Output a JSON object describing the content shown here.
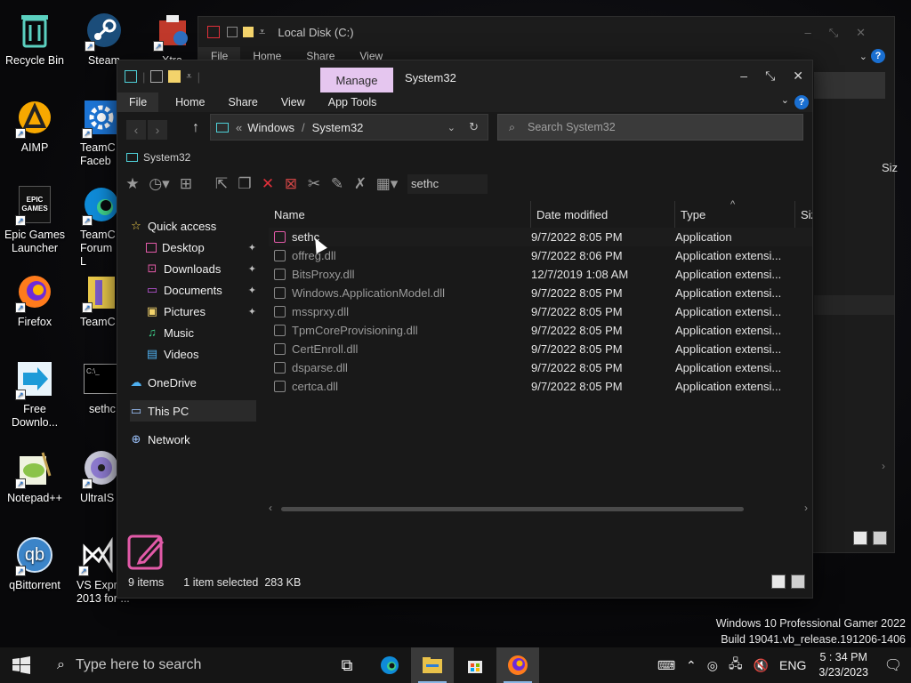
{
  "desktop": {
    "icons": [
      {
        "label": "Recycle Bin"
      },
      {
        "label": "Steam"
      },
      {
        "label": "Xtra"
      },
      {
        "label": "AIMP"
      },
      {
        "label": "TeamC Faceb"
      },
      {
        "label": "Epic Games Launcher"
      },
      {
        "label": "TeamC Forum L"
      },
      {
        "label": "Firefox"
      },
      {
        "label": "TeamC"
      },
      {
        "label": "Free Downlo..."
      },
      {
        "label": "sethc"
      },
      {
        "label": "Notepad++"
      },
      {
        "label": "UltraIS"
      },
      {
        "label": "qBittorrent"
      },
      {
        "label": "VS Expr 2013 for ..."
      }
    ],
    "icon_texts": {
      "epic": "EPIC GAMES",
      "qbit": "qb",
      "cmd": "C:\\_"
    }
  },
  "bg_window": {
    "title": "Local Disk (C:)",
    "tabs": [
      "File",
      "Home",
      "Share",
      "View"
    ],
    "partial_col": "Siz"
  },
  "window": {
    "manage_tab": "Manage",
    "title": "System32",
    "ribbon_tabs": [
      "File",
      "Home",
      "Share",
      "View",
      "App Tools"
    ],
    "help_label": "?",
    "address": {
      "prefix": "«",
      "segments": [
        "Windows",
        "System32"
      ]
    },
    "search_placeholder": "Search System32",
    "breadcrumb": "System32",
    "filter_text": "sethc",
    "nav": [
      {
        "label": "Quick access",
        "icon": "star-icon"
      },
      {
        "label": "Desktop",
        "icon": "desktop-icon",
        "pinned": true
      },
      {
        "label": "Downloads",
        "icon": "download-icon",
        "pinned": true
      },
      {
        "label": "Documents",
        "icon": "documents-icon",
        "pinned": true
      },
      {
        "label": "Pictures",
        "icon": "pictures-icon",
        "pinned": true
      },
      {
        "label": "Music",
        "icon": "music-icon"
      },
      {
        "label": "Videos",
        "icon": "videos-icon"
      },
      {
        "label": "OneDrive",
        "icon": "cloud-icon"
      },
      {
        "label": "This PC",
        "icon": "pc-icon"
      },
      {
        "label": "Network",
        "icon": "network-icon"
      }
    ],
    "columns": [
      "Name",
      "Date modified",
      "Type",
      "Siz"
    ],
    "files": [
      {
        "name": "sethc",
        "date": "9/7/2022 8:05 PM",
        "type": "Application"
      },
      {
        "name": "offreg.dll",
        "date": "9/7/2022 8:06 PM",
        "type": "Application extensi..."
      },
      {
        "name": "BitsProxy.dll",
        "date": "12/7/2019 1:08 AM",
        "type": "Application extensi..."
      },
      {
        "name": "Windows.ApplicationModel.dll",
        "date": "9/7/2022 8:05 PM",
        "type": "Application extensi..."
      },
      {
        "name": "mssprxy.dll",
        "date": "9/7/2022 8:05 PM",
        "type": "Application extensi..."
      },
      {
        "name": "TpmCoreProvisioning.dll",
        "date": "9/7/2022 8:05 PM",
        "type": "Application extensi..."
      },
      {
        "name": "CertEnroll.dll",
        "date": "9/7/2022 8:05 PM",
        "type": "Application extensi..."
      },
      {
        "name": "dsparse.dll",
        "date": "9/7/2022 8:05 PM",
        "type": "Application extensi..."
      },
      {
        "name": "certca.dll",
        "date": "9/7/2022 8:05 PM",
        "type": "Application extensi..."
      }
    ],
    "status": {
      "count": "9 items",
      "selection": "1 item selected  283 KB"
    }
  },
  "watermark": {
    "line1": "Windows 10 Professional Gamer 2022",
    "line2": "Build 19041.vb_release.191206-1406"
  },
  "taskbar": {
    "search_placeholder": "Type here to search",
    "lang": "ENG",
    "time": "5 : 34 PM",
    "date": "3/23/2023"
  },
  "colors": {
    "accent": "#1a6fd1",
    "manage_tab": "#e5c6ef",
    "app_icon": "#e25aa8",
    "folder": "#4fd0d8",
    "delete": "#e0303a"
  }
}
